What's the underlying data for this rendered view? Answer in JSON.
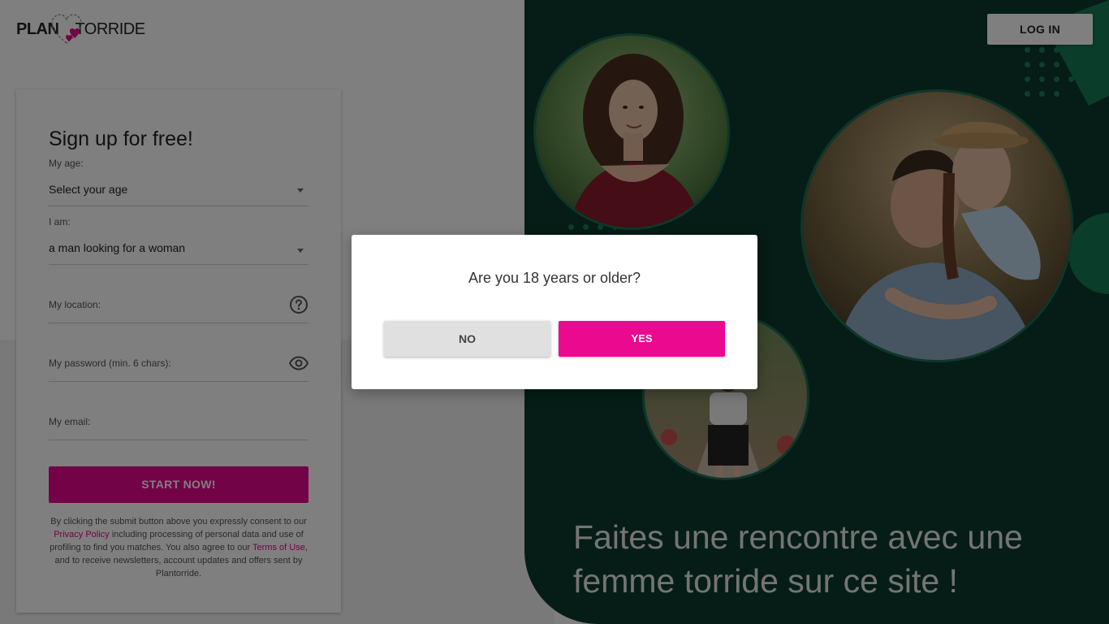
{
  "brand": {
    "logo_plan": "PLAN",
    "logo_torride": "TORRIDE",
    "accent_color": "#e6068f",
    "panel_color": "#0b3b2c"
  },
  "header": {
    "login_label": "LOG IN"
  },
  "signup": {
    "title": "Sign up for free!",
    "age_label": "My age:",
    "age_value": "Select your age",
    "iam_label": "I am:",
    "iam_value": "a man looking for a woman",
    "location_label": "My location:",
    "password_label": "My password (min. 6 chars):",
    "email_label": "My email:",
    "submit_label": "START NOW!",
    "legal": {
      "part1": "By clicking the submit button above you expressly consent to our ",
      "privacy_link": "Privacy Policy",
      "part2": " including processing of personal data and use of profiling to find you matches. You also agree to our ",
      "terms_link": "Terms of Use",
      "part3": ", and to receive newsletters, account updates and offers sent by Plantorride."
    }
  },
  "hero": {
    "tagline": "Faites une rencontre avec une femme torride sur ce site !"
  },
  "modal": {
    "question": "Are you 18 years or older?",
    "no_label": "NO",
    "yes_label": "YES"
  }
}
